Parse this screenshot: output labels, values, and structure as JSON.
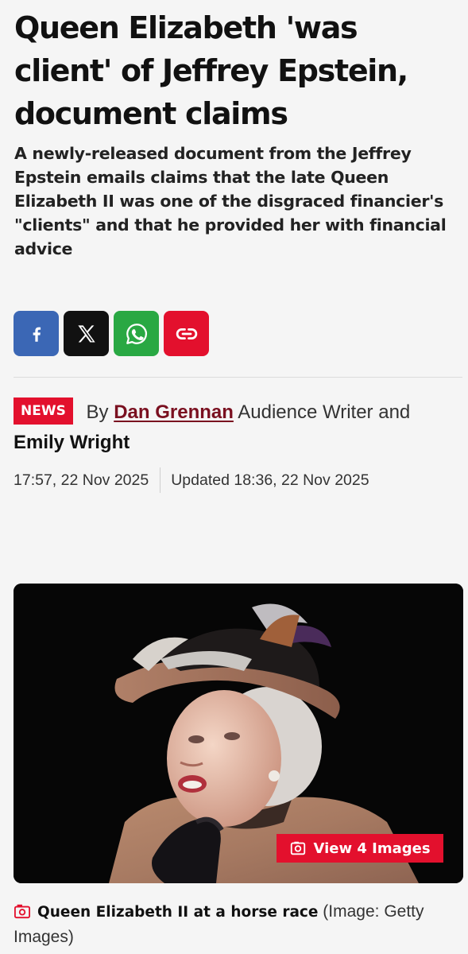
{
  "article": {
    "headline": "Queen Elizabeth 'was client' of Jeffrey Epstein, document claims",
    "standfirst": "A newly-released document from the Jeffrey Epstein emails claims that the late Queen Elizabeth II was one of the disgraced financier's \"clients\" and that he provided her with financial advice"
  },
  "share": {
    "icons": [
      "facebook-icon",
      "x-icon",
      "whatsapp-icon",
      "link-icon"
    ],
    "colors": {
      "facebook": "#3b67b5",
      "x": "#111111",
      "whatsapp": "#29a843",
      "link": "#e3102d"
    }
  },
  "byline": {
    "badge": "NEWS",
    "by": "By",
    "author1": "Dan Grennan",
    "author1_role": "Audience Writer",
    "and": "and",
    "author2": "Emily Wright"
  },
  "dates": {
    "published": "17:57, 22 Nov 2025",
    "updated": "Updated 18:36, 22 Nov 2025"
  },
  "image": {
    "view_label": "View 4 Images",
    "caption": "Queen Elizabeth II at a horse race",
    "credit": "(Image: Getty Images)"
  },
  "theme": {
    "accent": "#e3102d",
    "author_link": "#7a1020"
  }
}
